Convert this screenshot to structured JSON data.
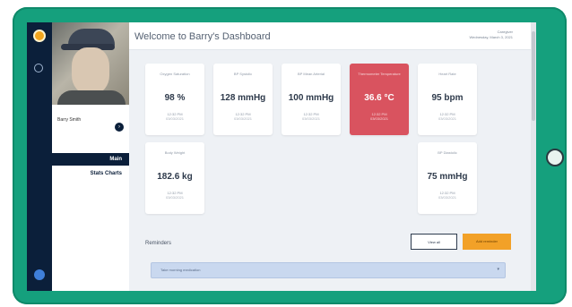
{
  "app": {
    "title": "Welcome to Barry's Dashboard",
    "user_name": "Caregiver",
    "date_text": "Wednesday, March 3, 2021"
  },
  "sidebar": {
    "user_label": "Barry Smith",
    "items": [
      {
        "label": "Main",
        "active": true
      },
      {
        "label": "Stats Charts",
        "active": false
      }
    ]
  },
  "cards": [
    {
      "label": "Oxygen Saturation",
      "value": "98 %",
      "sub1": "12:32 PM",
      "sub2": "03/03/2021",
      "alert": false
    },
    {
      "label": "BP Systolic",
      "value": "128 mmHg",
      "sub1": "12:32 PM",
      "sub2": "03/03/2021",
      "alert": false
    },
    {
      "label": "BP Mean Arterial",
      "value": "100 mmHg",
      "sub1": "12:32 PM",
      "sub2": "03/03/2021",
      "alert": false
    },
    {
      "label": "Thermometer Temperature",
      "value": "36.6 °C",
      "sub1": "12:32 PM",
      "sub2": "03/03/2021",
      "alert": true
    },
    {
      "label": "Heart Rate",
      "value": "95 bpm",
      "sub1": "12:32 PM",
      "sub2": "03/03/2021",
      "alert": false
    },
    {
      "label": "Body Weight",
      "value": "182.6 kg",
      "sub1": "12:32 PM",
      "sub2": "03/03/2021",
      "alert": false
    },
    {
      "label": "BP Diastolic",
      "value": "75 mmHg",
      "sub1": "12:32 PM",
      "sub2": "03/03/2021",
      "alert": false
    }
  ],
  "reminders": {
    "title": "Reminders",
    "button_outline": "View all",
    "button_primary": "Add reminder",
    "dropdown_text": "Take morning medication"
  },
  "colors": {
    "tablet_frame": "#15a07d",
    "nav_dark": "#0b1f3a",
    "alert_card": "#d9535f",
    "primary_button": "#f2a128"
  },
  "icons": [
    "logo-icon",
    "circle-icon",
    "user-arrow-icon",
    "help-icon",
    "chevron-down-icon",
    "home-button"
  ]
}
